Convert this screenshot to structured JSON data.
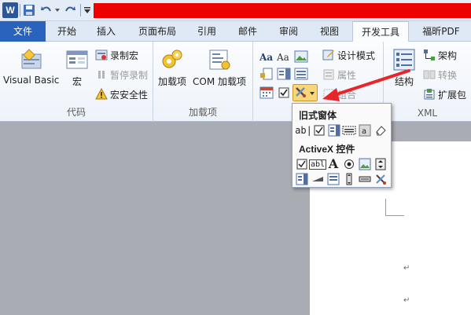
{
  "quick_access": {
    "logo_letter": "W",
    "icons": [
      "save-icon",
      "undo-icon",
      "redo-icon",
      "customize-icon"
    ]
  },
  "tabs": [
    {
      "label": "文件",
      "selected": false
    },
    {
      "label": "开始",
      "selected": false
    },
    {
      "label": "插入",
      "selected": false
    },
    {
      "label": "页面布局",
      "selected": false
    },
    {
      "label": "引用",
      "selected": false
    },
    {
      "label": "邮件",
      "selected": false
    },
    {
      "label": "审阅",
      "selected": false
    },
    {
      "label": "视图",
      "selected": false
    },
    {
      "label": "开发工具",
      "selected": true
    },
    {
      "label": "福昕PDF",
      "selected": false
    }
  ],
  "ribbon": {
    "code_group": {
      "label": "代码",
      "visual_basic": "Visual Basic",
      "macro": "宏",
      "record_macro": "录制宏",
      "pause_record": "暂停录制",
      "macro_security": "宏安全性"
    },
    "addins_group": {
      "label": "加载项",
      "addins": "加载项",
      "com_addins": "COM 加载项"
    },
    "controls_group": {
      "design_mode": "设计模式",
      "properties": "属性",
      "group": "组合"
    },
    "xml_group": {
      "label": "XML",
      "structure": "结构",
      "schema": "架构",
      "transform": "转换",
      "expansion_pack": "扩展包"
    }
  },
  "dropdown": {
    "legacy_title": "旧式窗体",
    "activex_title": "ActiveX 控件",
    "legacy_text_icon_label": "ab|",
    "activex_text_icon_label": "abl",
    "activex_label_glyph": "A"
  },
  "colors": {
    "file_tab": "#2a63bd",
    "redbar": "#ee0000",
    "arrow": "#e8262a",
    "doc_background": "#a9acb3"
  }
}
